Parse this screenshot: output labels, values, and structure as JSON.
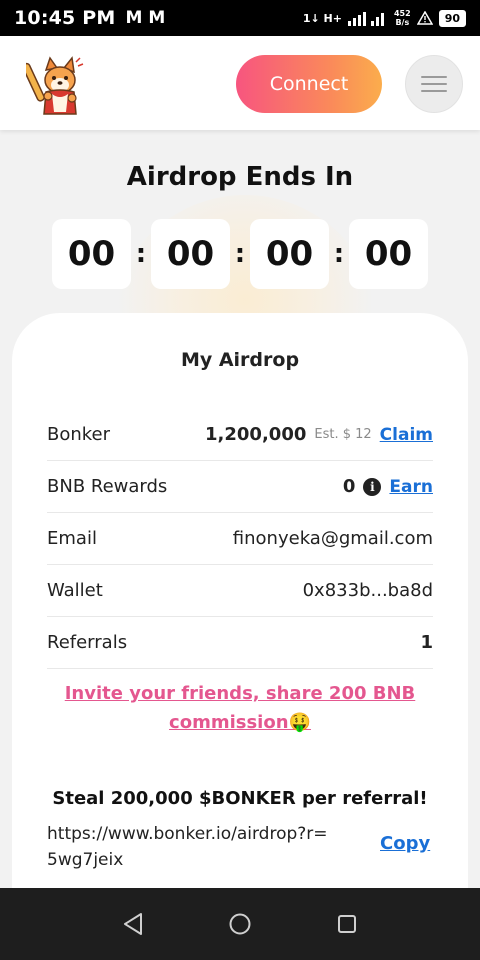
{
  "status_bar": {
    "time": "10:45 PM",
    "mail_icons": "M M",
    "network": "1↓ H+",
    "speed_value": "452",
    "speed_unit": "B/s",
    "battery": "90"
  },
  "header": {
    "logo_icon": "shiba-dog-with-bat-icon",
    "connect_label": "Connect",
    "menu_icon": "hamburger-menu-icon"
  },
  "countdown": {
    "title": "Airdrop Ends In",
    "units": [
      "00",
      "00",
      "00",
      "00"
    ],
    "separator": ":"
  },
  "airdrop": {
    "title": "My Airdrop",
    "rows": [
      {
        "label": "Bonker",
        "value": "1,200,000",
        "estimate": "Est. $ 12",
        "action": "Claim"
      },
      {
        "label": "BNB Rewards",
        "value": "0",
        "info_icon": "info-icon",
        "action": "Earn"
      },
      {
        "label": "Email",
        "value": "finonyeka@gmail.com"
      },
      {
        "label": "Wallet",
        "value": "0x833b...ba8d"
      },
      {
        "label": "Referrals",
        "value": "1"
      }
    ],
    "invite_text": "Invite your friends, share 200 BNB commission🤑",
    "steal_text": "Steal 200,000 $BONKER per referral!",
    "referral_link": "https://www.bonker.io/airdrop?r=5wg7jeix",
    "copy_label": "Copy"
  },
  "nav_bar": {
    "back_icon": "back-triangle-icon",
    "home_icon": "home-circle-icon",
    "recents_icon": "recents-square-icon"
  },
  "colors": {
    "accent_link": "#1a6fd6",
    "invite_pink": "#e4578f",
    "connect_gradient_start": "#f7557f",
    "connect_gradient_end": "#fbad4c"
  }
}
